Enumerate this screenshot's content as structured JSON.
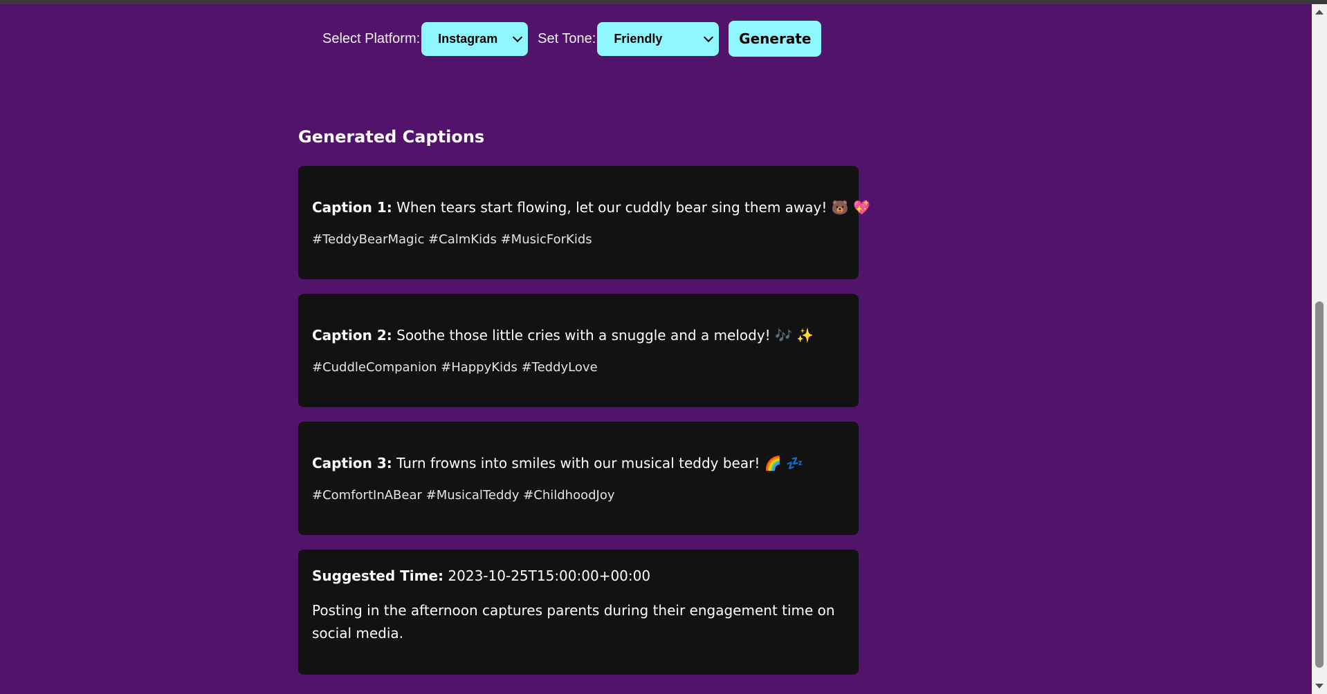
{
  "controls": {
    "platform_label": "Select Platform:",
    "platform_value": "Instagram",
    "tone_label": "Set Tone:",
    "tone_value": "Friendly",
    "generate_label": "Generate"
  },
  "results": {
    "heading": "Generated Captions",
    "captions": [
      {
        "label": "Caption 1:",
        "text": "When tears start flowing, let our cuddly bear sing them away! 🐻 💖",
        "hashtags": "#TeddyBearMagic #CalmKids #MusicForKids"
      },
      {
        "label": "Caption 2:",
        "text": "Soothe those little cries with a snuggle and a melody! 🎶 ✨",
        "hashtags": "#CuddleCompanion #HappyKids #TeddyLove"
      },
      {
        "label": "Caption 3:",
        "text": "Turn frowns into smiles with our musical teddy bear! 🌈 💤",
        "hashtags": "#ComfortInABear #MusicalTeddy #ChildhoodJoy"
      }
    ],
    "suggested_time_label": "Suggested Time:",
    "suggested_time_value": "2023-10-25T15:00:00+00:00",
    "reason": "Posting in the afternoon captures parents during their engagement time on social media."
  },
  "colors": {
    "background": "#51146a",
    "card": "#121212",
    "accent": "#8ff8ff"
  }
}
